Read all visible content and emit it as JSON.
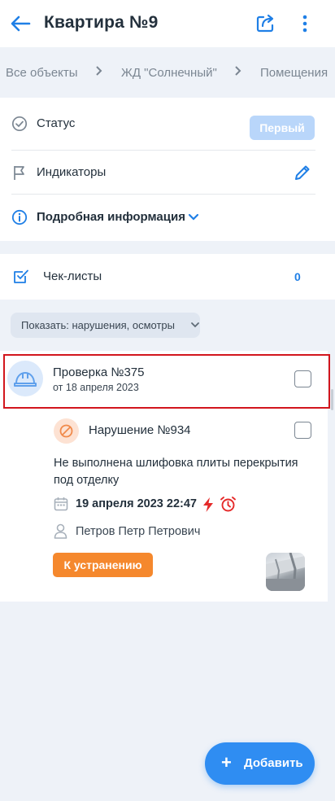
{
  "header": {
    "title": "Квартира №9",
    "back_icon": "arrow-left-icon",
    "share_icon": "share-icon",
    "more_icon": "more-vertical-icon"
  },
  "breadcrumbs": [
    "Все объекты",
    "ЖД \"Солнечный\"",
    "Помещения"
  ],
  "details": {
    "status_label": "Статус",
    "status_value": "Первый",
    "indicators_label": "Индикаторы",
    "more_info_label": "Подробная информация"
  },
  "checklists": {
    "label": "Чек-листы",
    "count": "0"
  },
  "filter": {
    "label": "Показать: нарушения, осмотры"
  },
  "inspection": {
    "title": "Проверка №375",
    "date": "от 18 апреля 2023"
  },
  "violation": {
    "title": "Нарушение №934",
    "description": "Не выполнена шлифовка плиты перекрытия под отделку",
    "datetime": "19 апреля 2023 22:47",
    "assignee": "Петров Петр Петрович",
    "status_button": "К устранению"
  },
  "fab": {
    "label": "Добавить",
    "plus": "+"
  },
  "colors": {
    "accent": "#1f7fe6",
    "status_orange": "#f5882d",
    "highlight_red": "#d2161d",
    "urgent_red": "#e52a2a"
  }
}
